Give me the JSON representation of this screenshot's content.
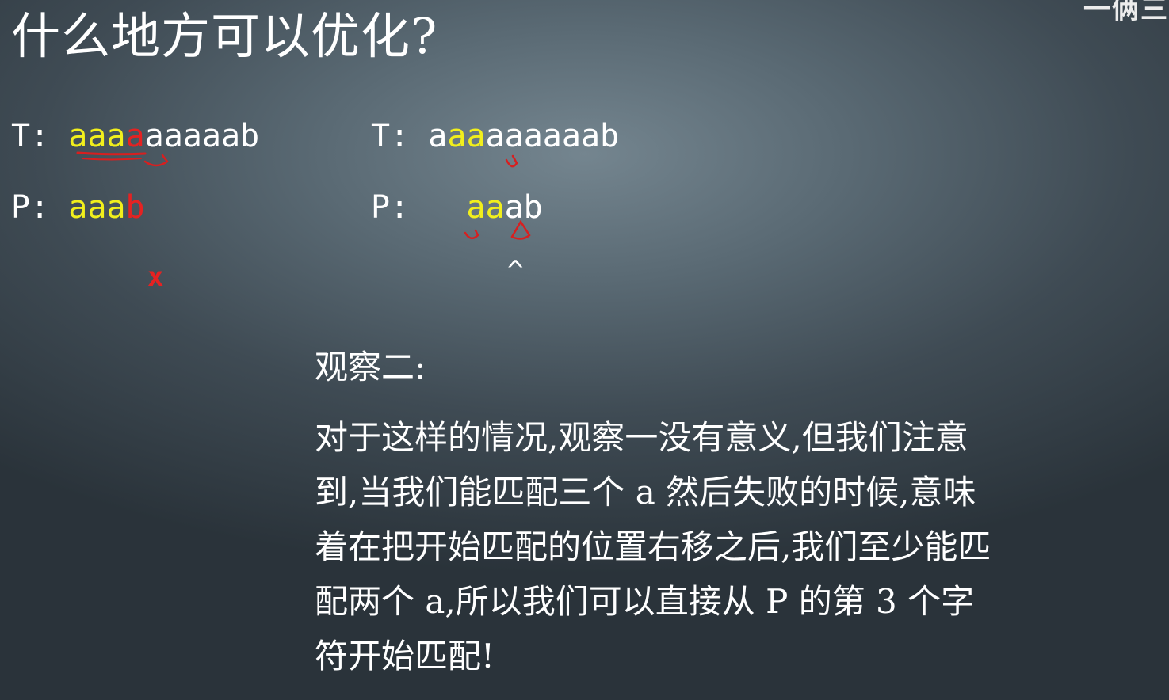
{
  "slide": {
    "title": "什么地方可以优化?",
    "watermark": "一俩三"
  },
  "example_left": {
    "t_label": "T:",
    "t_matched": "aaa",
    "t_mismatch": "a",
    "t_rest": "aaaaab",
    "p_label": "P:",
    "p_matched": "aaa",
    "p_mismatch": "b",
    "mismatch_mark": "x"
  },
  "example_right": {
    "t_label": "T:",
    "t_prefix": "a",
    "t_matched": "aa",
    "t_rest": "aaaaaab",
    "p_label": "P:",
    "p_matched": "aa",
    "p_rest": "ab",
    "pointer": "^"
  },
  "observation": {
    "heading": "观察二:",
    "lines": [
      "对于这样的情况,观察一没有意义,但我们注意",
      "到,当我们能匹配三个 a 然后失败的时候,意味",
      "着在把开始匹配的位置右移之后,我们至少能匹",
      "配两个 a,所以我们可以直接从 P 的第 3 个字",
      "符开始匹配!"
    ]
  },
  "colors": {
    "matched": "#f1ef1c",
    "mismatch": "#e52222",
    "text": "#ffffff"
  }
}
